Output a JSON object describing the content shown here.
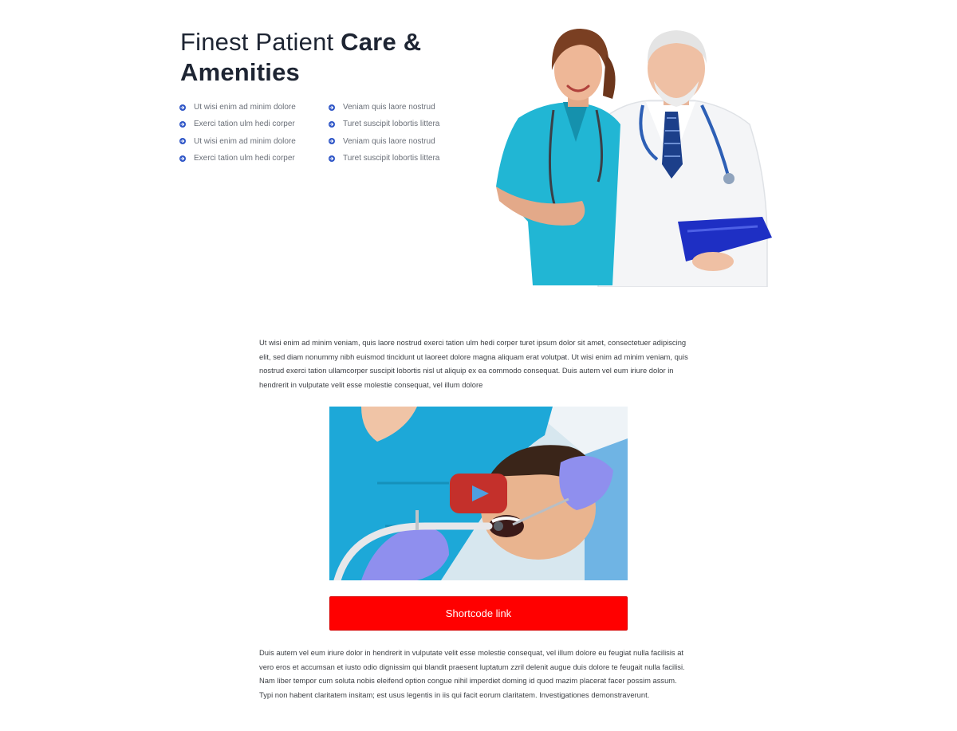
{
  "hero": {
    "title_light": "Finest Patient ",
    "title_bold": "Care & Amenities",
    "features_left": [
      "Ut wisi enim ad minim dolore",
      "Exerci tation ulm hedi corper",
      "Ut wisi enim ad minim dolore",
      "Exerci tation ulm hedi corper"
    ],
    "features_right": [
      "Veniam quis laore nostrud",
      "Turet suscipit lobortis littera",
      "Veniam quis laore nostrud",
      "Turet suscipit lobortis littera"
    ],
    "bullet_icon": "circle-arrow-right-icon",
    "bullet_color": "#2f56c7"
  },
  "content": {
    "paragraph_1": "Ut wisi enim ad minim veniam, quis laore nostrud exerci tation ulm hedi corper turet ipsum dolor sit amet, consectetuer adipiscing elit, sed diam nonummy nibh euismod tincidunt ut laoreet dolore magna aliquam erat volutpat. Ut wisi enim ad minim veniam, quis nostrud exerci tation ullamcorper suscipit lobortis nisl ut aliquip ex ea commodo consequat. Duis autem vel eum iriure dolor in hendrerit in vulputate velit esse molestie consequat, vel illum dolore",
    "paragraph_2": "Duis autem vel eum iriure dolor in hendrerit in vulputate velit esse molestie consequat, vel illum dolore eu feugiat nulla facilisis at vero eros et accumsan et iusto odio dignissim qui blandit praesent luptatum zzril delenit augue duis dolore te feugait nulla facilisi. Nam liber tempor cum soluta nobis eleifend option congue nihil imperdiet doming id quod mazim placerat facer possim assum. Typi non habent claritatem insitam; est usus legentis in iis qui facit eorum claritatem. Investigationes demonstraverunt."
  },
  "video": {
    "play_icon": "play-icon",
    "play_color": "#c4302b"
  },
  "cta": {
    "label": "Shortcode link",
    "color": "#ff0000"
  }
}
